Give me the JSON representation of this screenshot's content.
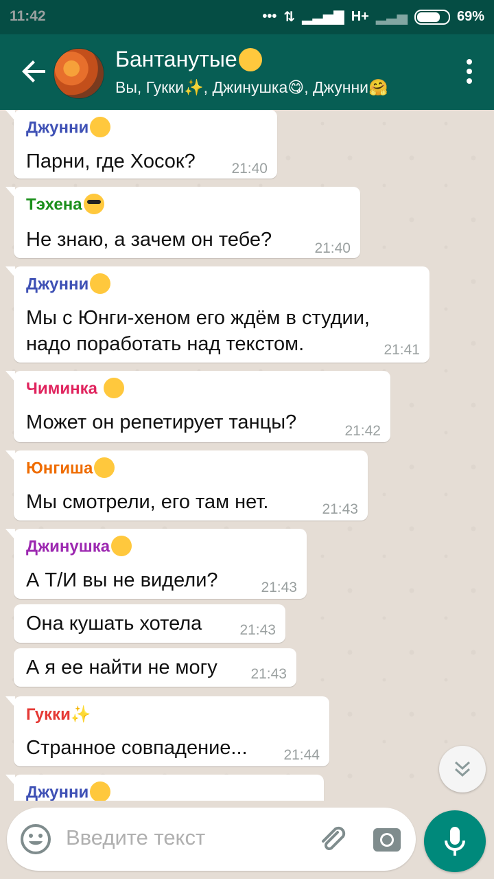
{
  "status_bar": {
    "time": "11:42",
    "network": "H+",
    "battery": "69%",
    "battery_level": 0.69
  },
  "chat_header": {
    "title": "Бантанутые",
    "title_emoji_icon": "heart-eyes-cat-icon",
    "subtitle": "Вы, Гукки✨, Джинушка😋, Джунни🤗"
  },
  "messages": [
    {
      "sender": "Джунни",
      "sender_color": "#3f51b5",
      "sender_emoji": "hugging-face-icon",
      "text": "Парни, где Хосок?",
      "time": "21:40"
    },
    {
      "sender": "Тэхена",
      "sender_color": "#1b8f1b",
      "sender_emoji": "sunglasses-face-icon",
      "text": "Не знаю, а зачем он тебе?",
      "time": "21:40"
    },
    {
      "sender": "Джунни",
      "sender_color": "#3f51b5",
      "sender_emoji": "hugging-face-icon",
      "text_lines": [
        "Мы с Юнги-хеном его ждём в студии,",
        "надо поработать над текстом."
      ],
      "time": "21:41"
    },
    {
      "sender": "Чиминка",
      "sender_color": "#e0245e",
      "sender_emoji": "smiling-face-icon",
      "text": "Может он репетирует танцы?",
      "time": "21:42"
    },
    {
      "sender": "Юнгиша",
      "sender_color": "#ef6c00",
      "sender_emoji": "relieved-face-icon",
      "text": "Мы смотрели, его там нет.",
      "time": "21:43"
    },
    {
      "sender": "Джинушка",
      "sender_color": "#9c27b0",
      "sender_emoji": "yum-face-icon",
      "text": "А Т/И вы не видели?",
      "time": "21:43"
    },
    {
      "text": " Она кушать хотела",
      "time": "21:43"
    },
    {
      "text": "А я ее найти не могу",
      "time": "21:43"
    },
    {
      "sender": "Гукки",
      "sender_color": "#e53935",
      "sender_emoji": "sparkles-icon",
      "text": "Странное совпадение...",
      "time": "21:44"
    },
    {
      "sender": "Джунни",
      "sender_color": "#3f51b5",
      "sender_emoji": "hugging-face-icon",
      "text": "",
      "time": ""
    }
  ],
  "input": {
    "placeholder": "Введите текст"
  },
  "colors": {
    "header": "#075e54",
    "status_bar": "#054d44",
    "accent": "#00897b",
    "chat_background": "#e5ddd5"
  }
}
